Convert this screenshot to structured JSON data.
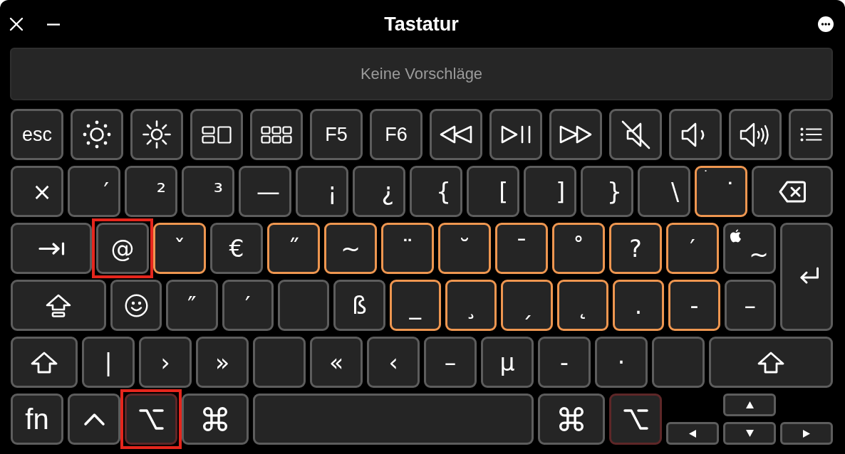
{
  "window": {
    "title": "Tastatur"
  },
  "suggestion_bar": {
    "text": "Keine Vorschläge"
  },
  "rows": [
    {
      "keys": [
        {
          "kind": "word",
          "label": "esc",
          "dead": false,
          "pressed": false,
          "highlighted": false
        },
        {
          "kind": "dim",
          "dead": false,
          "pressed": false,
          "highlighted": false
        },
        {
          "kind": "bright",
          "dead": false,
          "pressed": false,
          "highlighted": false
        },
        {
          "kind": "mission",
          "dead": false,
          "pressed": false,
          "highlighted": false
        },
        {
          "kind": "launchpad",
          "dead": false,
          "pressed": false,
          "highlighted": false
        },
        {
          "kind": "word",
          "label": "F5",
          "dead": false,
          "pressed": false,
          "highlighted": false
        },
        {
          "kind": "word",
          "label": "F6",
          "dead": false,
          "pressed": false,
          "highlighted": false
        },
        {
          "kind": "rewind",
          "dead": false,
          "pressed": false,
          "highlighted": false
        },
        {
          "kind": "playpause",
          "dead": false,
          "pressed": false,
          "highlighted": false
        },
        {
          "kind": "forward",
          "dead": false,
          "pressed": false,
          "highlighted": false
        },
        {
          "kind": "mute",
          "dead": false,
          "pressed": false,
          "highlighted": false
        },
        {
          "kind": "quieter",
          "dead": false,
          "pressed": false,
          "highlighted": false
        },
        {
          "kind": "louder",
          "dead": false,
          "pressed": false,
          "highlighted": false
        },
        {
          "kind": "list",
          "dead": false,
          "pressed": false,
          "highlighted": false
        }
      ]
    },
    {
      "keys": [
        {
          "kind": "char",
          "label": "×",
          "dead": false,
          "pressed": false,
          "highlighted": false
        },
        {
          "kind": "char",
          "label": "′",
          "dead": false,
          "pressed": false,
          "highlighted": false
        },
        {
          "kind": "char",
          "label": "²",
          "dead": false,
          "pressed": false,
          "highlighted": false
        },
        {
          "kind": "char",
          "label": "³",
          "dead": false,
          "pressed": false,
          "highlighted": false
        },
        {
          "kind": "char",
          "label": "—",
          "dead": false,
          "pressed": false,
          "highlighted": false
        },
        {
          "kind": "char",
          "label": "¡",
          "dead": false,
          "pressed": false,
          "highlighted": false
        },
        {
          "kind": "char",
          "label": "¿",
          "dead": false,
          "pressed": false,
          "highlighted": false
        },
        {
          "kind": "char",
          "label": "{",
          "dead": false,
          "pressed": false,
          "highlighted": false
        },
        {
          "kind": "char",
          "label": "[",
          "dead": false,
          "pressed": false,
          "highlighted": false
        },
        {
          "kind": "char",
          "label": "]",
          "dead": false,
          "pressed": false,
          "highlighted": false
        },
        {
          "kind": "char",
          "label": "}",
          "dead": false,
          "pressed": false,
          "highlighted": false
        },
        {
          "kind": "char",
          "label": "\\",
          "dead": false,
          "pressed": false,
          "highlighted": false
        },
        {
          "kind": "char",
          "label": "˙",
          "corner": "˙",
          "dead": true,
          "pressed": false,
          "highlighted": false
        },
        {
          "kind": "delete",
          "dead": false,
          "pressed": false,
          "highlighted": false
        }
      ]
    },
    {
      "keys": [
        {
          "kind": "tab",
          "dead": false,
          "pressed": false,
          "highlighted": false
        },
        {
          "kind": "char",
          "label": "@",
          "dead": false,
          "pressed": false,
          "highlighted": true
        },
        {
          "kind": "char",
          "label": "ˇ",
          "dead": true,
          "pressed": false,
          "highlighted": false
        },
        {
          "kind": "char",
          "label": "€",
          "dead": false,
          "pressed": false,
          "highlighted": false
        },
        {
          "kind": "char",
          "label": "˝",
          "dead": true,
          "pressed": false,
          "highlighted": false
        },
        {
          "kind": "char",
          "label": "~",
          "dead": true,
          "pressed": false,
          "highlighted": false
        },
        {
          "kind": "char",
          "label": "¨",
          "dead": true,
          "pressed": false,
          "highlighted": false
        },
        {
          "kind": "char",
          "label": "˘",
          "dead": true,
          "pressed": false,
          "highlighted": false
        },
        {
          "kind": "char",
          "label": "¯",
          "dead": true,
          "pressed": false,
          "highlighted": false
        },
        {
          "kind": "char",
          "label": "˚",
          "dead": true,
          "pressed": false,
          "highlighted": false
        },
        {
          "kind": "char",
          "label": "?",
          "dead": true,
          "pressed": false,
          "highlighted": false
        },
        {
          "kind": "char",
          "label": "′",
          "dead": true,
          "pressed": false,
          "highlighted": false
        },
        {
          "kind": "apple",
          "label": "~",
          "dead": false,
          "pressed": false,
          "highlighted": false
        },
        {
          "kind": "return",
          "dead": false,
          "pressed": false,
          "highlighted": false
        }
      ]
    },
    {
      "keys": [
        {
          "kind": "capslock",
          "dead": false,
          "pressed": false,
          "highlighted": false
        },
        {
          "kind": "emoji",
          "dead": false,
          "pressed": false,
          "highlighted": false
        },
        {
          "kind": "char",
          "label": "″",
          "dead": false,
          "pressed": false,
          "highlighted": false
        },
        {
          "kind": "char",
          "label": "′",
          "dead": false,
          "pressed": false,
          "highlighted": false
        },
        {
          "kind": "blank",
          "dead": false,
          "pressed": false,
          "highlighted": false
        },
        {
          "kind": "char",
          "label": "ß",
          "dead": false,
          "pressed": false,
          "highlighted": false
        },
        {
          "kind": "char",
          "label": "_",
          "dead": true,
          "pressed": false,
          "highlighted": false
        },
        {
          "kind": "char",
          "label": "¸",
          "dead": true,
          "pressed": false,
          "highlighted": false
        },
        {
          "kind": "char",
          "label": "ˏ",
          "dead": true,
          "pressed": false,
          "highlighted": false
        },
        {
          "kind": "char",
          "label": "˛",
          "dead": true,
          "pressed": false,
          "highlighted": false
        },
        {
          "kind": "char",
          "label": ".",
          "dead": true,
          "pressed": false,
          "highlighted": false
        },
        {
          "kind": "char",
          "label": "-",
          "dead": true,
          "pressed": false,
          "highlighted": false
        },
        {
          "kind": "char",
          "label": "–",
          "dead": false,
          "pressed": false,
          "highlighted": false
        }
      ]
    },
    {
      "keys": [
        {
          "kind": "shift",
          "dead": false,
          "pressed": false,
          "highlighted": false
        },
        {
          "kind": "char",
          "label": "|",
          "dead": false,
          "pressed": false,
          "highlighted": false
        },
        {
          "kind": "char",
          "label": "›",
          "dead": false,
          "pressed": false,
          "highlighted": false
        },
        {
          "kind": "char",
          "label": "»",
          "dead": false,
          "pressed": false,
          "highlighted": false
        },
        {
          "kind": "blank",
          "dead": false,
          "pressed": false,
          "highlighted": false
        },
        {
          "kind": "char",
          "label": "«",
          "dead": false,
          "pressed": false,
          "highlighted": false
        },
        {
          "kind": "char",
          "label": "‹",
          "dead": false,
          "pressed": false,
          "highlighted": false
        },
        {
          "kind": "char",
          "label": "–",
          "dead": false,
          "pressed": false,
          "highlighted": false
        },
        {
          "kind": "char",
          "label": "µ",
          "dead": false,
          "pressed": false,
          "highlighted": false
        },
        {
          "kind": "char",
          "label": "-",
          "dead": false,
          "pressed": false,
          "highlighted": false
        },
        {
          "kind": "char",
          "label": "·",
          "dead": false,
          "pressed": false,
          "highlighted": false
        },
        {
          "kind": "blank",
          "dead": false,
          "pressed": false,
          "highlighted": false
        },
        {
          "kind": "shift",
          "dead": false,
          "pressed": false,
          "highlighted": false
        }
      ]
    },
    {
      "keys": [
        {
          "kind": "modword",
          "label": "fn",
          "dead": false,
          "pressed": false,
          "highlighted": false
        },
        {
          "kind": "control",
          "dead": false,
          "pressed": false,
          "highlighted": false
        },
        {
          "kind": "option",
          "dead": false,
          "pressed": true,
          "highlighted": true
        },
        {
          "kind": "command",
          "dead": false,
          "pressed": false,
          "highlighted": false
        },
        {
          "kind": "space",
          "dead": false,
          "pressed": false,
          "highlighted": false
        },
        {
          "kind": "command",
          "dead": false,
          "pressed": false,
          "highlighted": false
        },
        {
          "kind": "option",
          "dead": false,
          "pressed": true,
          "highlighted": false
        },
        {
          "kind": "up",
          "dead": false,
          "pressed": false,
          "highlighted": false
        },
        {
          "kind": "left",
          "dead": false,
          "pressed": false,
          "highlighted": false
        },
        {
          "kind": "down",
          "dead": false,
          "pressed": false,
          "highlighted": false
        },
        {
          "kind": "right",
          "dead": false,
          "pressed": false,
          "highlighted": false
        }
      ]
    }
  ]
}
